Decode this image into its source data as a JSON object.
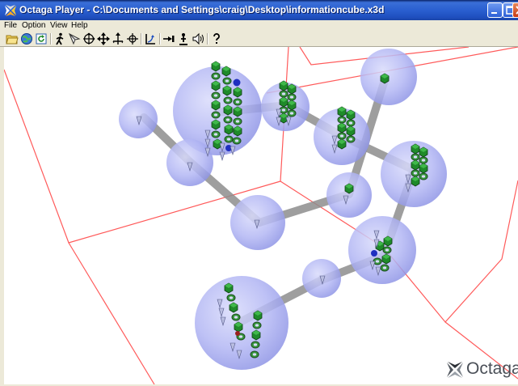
{
  "window": {
    "title": "Octaga Player - C:\\Documents and Settings\\craig\\Desktop\\informationcube.x3d",
    "app_icon": "octaga-logo-icon",
    "controls": [
      "minimize-icon",
      "maximize-icon",
      "close-icon"
    ]
  },
  "menu": {
    "items": [
      {
        "label": "File",
        "mnemonic": "F"
      },
      {
        "label": "Option",
        "mnemonic": "O"
      },
      {
        "label": "View",
        "mnemonic": "V"
      },
      {
        "label": "Help",
        "mnemonic": "H"
      }
    ]
  },
  "toolbar": {
    "buttons": [
      {
        "icon": "open-folder-icon"
      },
      {
        "icon": "open-url-globe-icon"
      },
      {
        "icon": "reload-icon"
      },
      {
        "icon": "walk-mode-icon"
      },
      {
        "icon": "fly-mode-icon"
      },
      {
        "icon": "examine-mode-icon"
      },
      {
        "icon": "pan-mode-icon"
      },
      {
        "icon": "tilt-mode-icon"
      },
      {
        "icon": "rotate-mode-icon"
      },
      {
        "icon": "straighten-icon"
      },
      {
        "icon": "headlight-icon"
      },
      {
        "icon": "collision-icon"
      },
      {
        "icon": "sound-icon"
      },
      {
        "icon": "help-icon"
      }
    ]
  },
  "viewport": {
    "background": "#ffffff",
    "wireframe_color": "#ff4040",
    "sphere_color": "#a9aef5",
    "connector_color": "#8d8d8d",
    "node_color": "#1a7a1a",
    "accent_node_color": "#1f2fc0"
  },
  "branding": {
    "logo_text": "Octaga"
  }
}
